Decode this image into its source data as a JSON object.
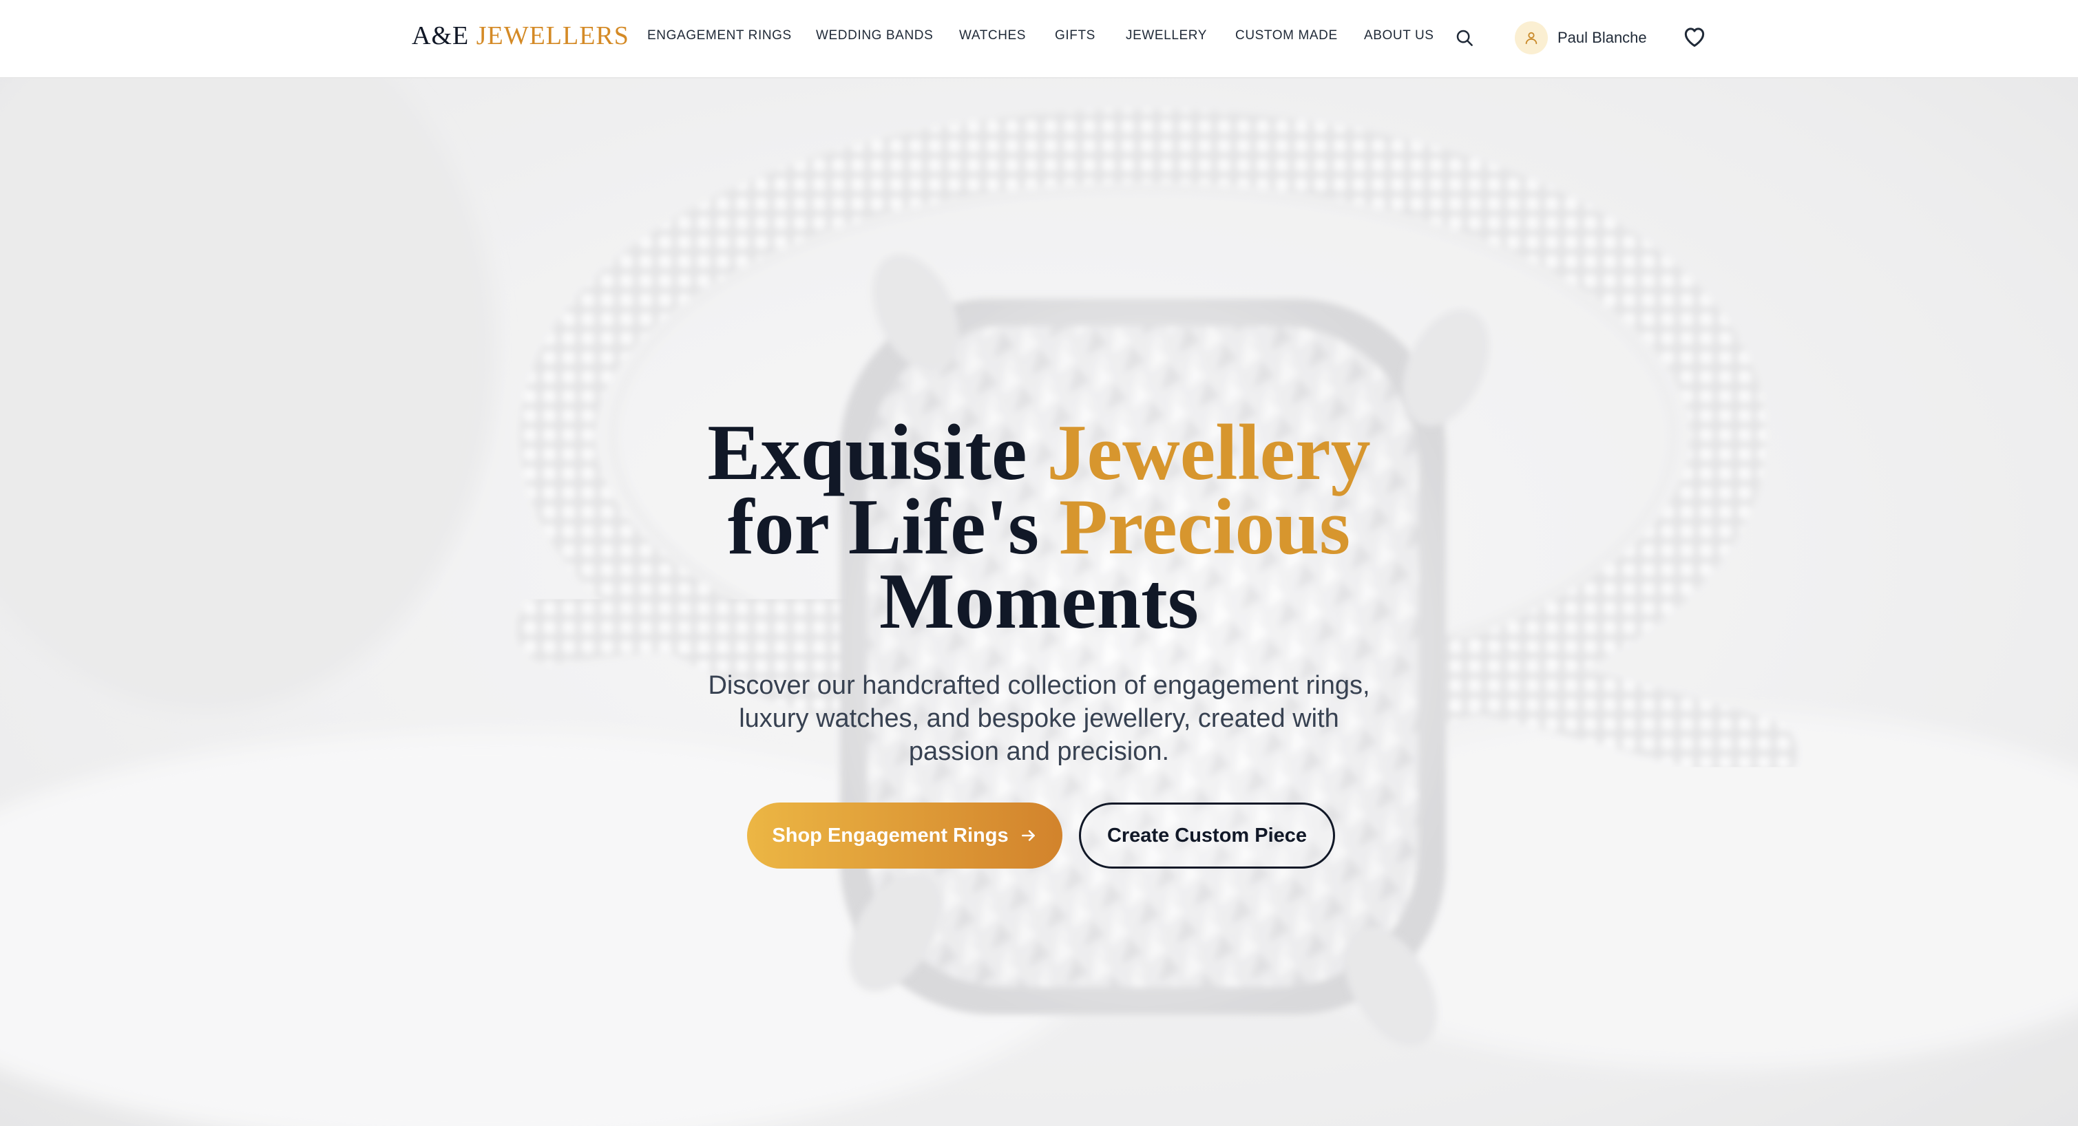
{
  "brand": {
    "part1": "A&E",
    "part2": "JEWELLERS",
    "colors": {
      "dark": "#111827",
      "gold": "#d48a26"
    }
  },
  "nav": {
    "items": [
      {
        "label": "ENGAGEMENT RINGS"
      },
      {
        "label": "WEDDING BANDS"
      },
      {
        "label": "WATCHES"
      },
      {
        "label": "GIFTS"
      },
      {
        "label": "JEWELLERY"
      },
      {
        "label": "CUSTOM MADE"
      },
      {
        "label": "ABOUT US"
      }
    ],
    "search_icon": "search-icon"
  },
  "user": {
    "name": "Paul Blanche",
    "icon": "user-icon"
  },
  "wishlist": {
    "icon": "heart-icon"
  },
  "hero": {
    "title_line1_a": "Exquisite",
    "title_line1_b": "Jewellery",
    "title_line2_a": "for Life's",
    "title_line2_b": "Precious",
    "title_line3": "Moments",
    "subtitle": "Discover our handcrafted collection of engagement rings, luxury watches, and bespoke jewellery, created with passion and precision.",
    "primary_cta": "Shop Engagement Rings",
    "primary_cta_icon": "arrow-right-icon",
    "secondary_cta": "Create Custom Piece",
    "colors": {
      "accent_start": "#ecb644",
      "accent_end": "#d2832c",
      "heading": "#111827"
    }
  }
}
